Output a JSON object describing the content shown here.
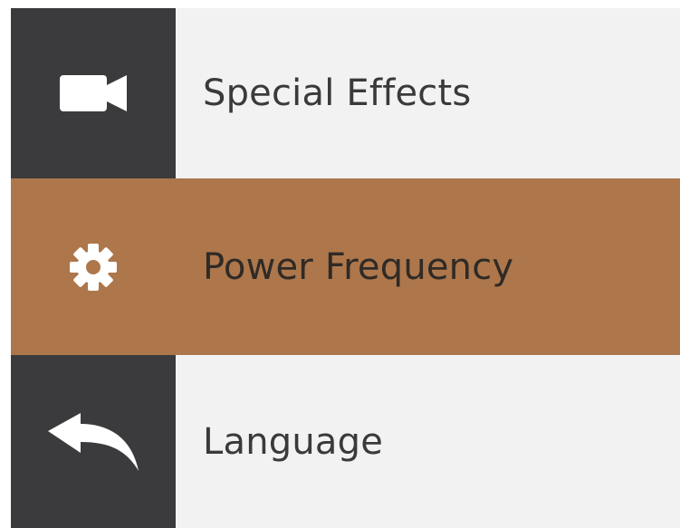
{
  "menu": {
    "items": [
      {
        "label": "Special Effects",
        "icon": "video-camera-icon",
        "selected": false
      },
      {
        "label": "Power Frequency",
        "icon": "gear-icon",
        "selected": true
      },
      {
        "label": "Language",
        "icon": "back-arrow-icon",
        "selected": false
      }
    ]
  },
  "colors": {
    "icon_column": "#3b3b3d",
    "row_background": "#f2f2f2",
    "selected_background": "#ad774b",
    "icon": "#ffffff",
    "text": "#3a3a3a"
  }
}
